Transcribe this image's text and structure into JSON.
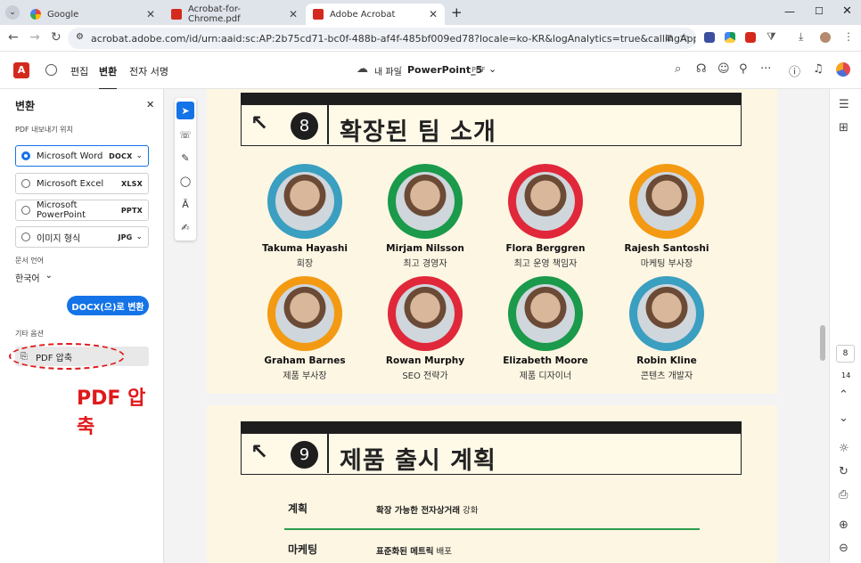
{
  "tabs": [
    {
      "title": "Google",
      "icon": "google-icon"
    },
    {
      "title": "Acrobat-for-Chrome.pdf",
      "icon": "acrobat-icon"
    },
    {
      "title": "Adobe Acrobat",
      "icon": "acrobat-icon"
    }
  ],
  "url": "acrobat.adobe.com/id/urn:aaid:sc:AP:2b75cd71-bc0f-488b-af4f-485bf009ed78?locale=ko-KR&logAnalytics=true&callingApp=efaidnbmnnnibpcajp...",
  "toolbar": {
    "edit": "편집",
    "convert": "변환",
    "esign": "전자 서명",
    "my_files": "내 파일",
    "doc_name": "PowerPoint_5",
    "doc_type": "PDF"
  },
  "panel": {
    "title": "변환",
    "export_label": "PDF 내보내기 위치",
    "options": [
      {
        "label": "Microsoft Word",
        "format": "DOCX",
        "selected": true
      },
      {
        "label": "Microsoft Excel",
        "format": "XLSX",
        "selected": false
      },
      {
        "label": "Microsoft PowerPoint",
        "format": "PPTX",
        "selected": false
      },
      {
        "label": "이미지 형식",
        "format": "JPG",
        "selected": false
      }
    ],
    "lang_label": "문서 언어",
    "lang_value": "한국어",
    "convert_button": "DOCX(으)로 변환",
    "other_label": "기타 옵션",
    "compress_label": "PDF 압축"
  },
  "annotation": "PDF 압축",
  "slide8": {
    "number": "8",
    "title": "확장된 팀 소개",
    "people": [
      {
        "name": "Takuma Hayashi",
        "role": "회장",
        "ring": "#3a9fc0"
      },
      {
        "name": "Mirjam Nilsson",
        "role": "최고 경영자",
        "ring": "#1a9a4a"
      },
      {
        "name": "Flora Berggren",
        "role": "최고 운영 책임자",
        "ring": "#e0283a"
      },
      {
        "name": "Rajesh Santoshi",
        "role": "마케팅 부사장",
        "ring": "#f39a12"
      },
      {
        "name": "Graham Barnes",
        "role": "제품 부사장",
        "ring": "#f39a12"
      },
      {
        "name": "Rowan Murphy",
        "role": "SEO 전략가",
        "ring": "#e0283a"
      },
      {
        "name": "Elizabeth Moore",
        "role": "제품 디자이너",
        "ring": "#1a9a4a"
      },
      {
        "name": "Robin Kline",
        "role": "콘텐츠 개발자",
        "ring": "#3a9fc0"
      }
    ]
  },
  "slide9": {
    "number": "9",
    "title": "제품 출시 계획",
    "rows": [
      {
        "label": "계획",
        "bold": "확장 가능한 전자상거래",
        "rest": " 강화"
      },
      {
        "label": "마케팅",
        "bold": "표준화된 메트릭",
        "rest": " 배포"
      }
    ]
  },
  "rail": {
    "page": "8",
    "total": "14"
  }
}
